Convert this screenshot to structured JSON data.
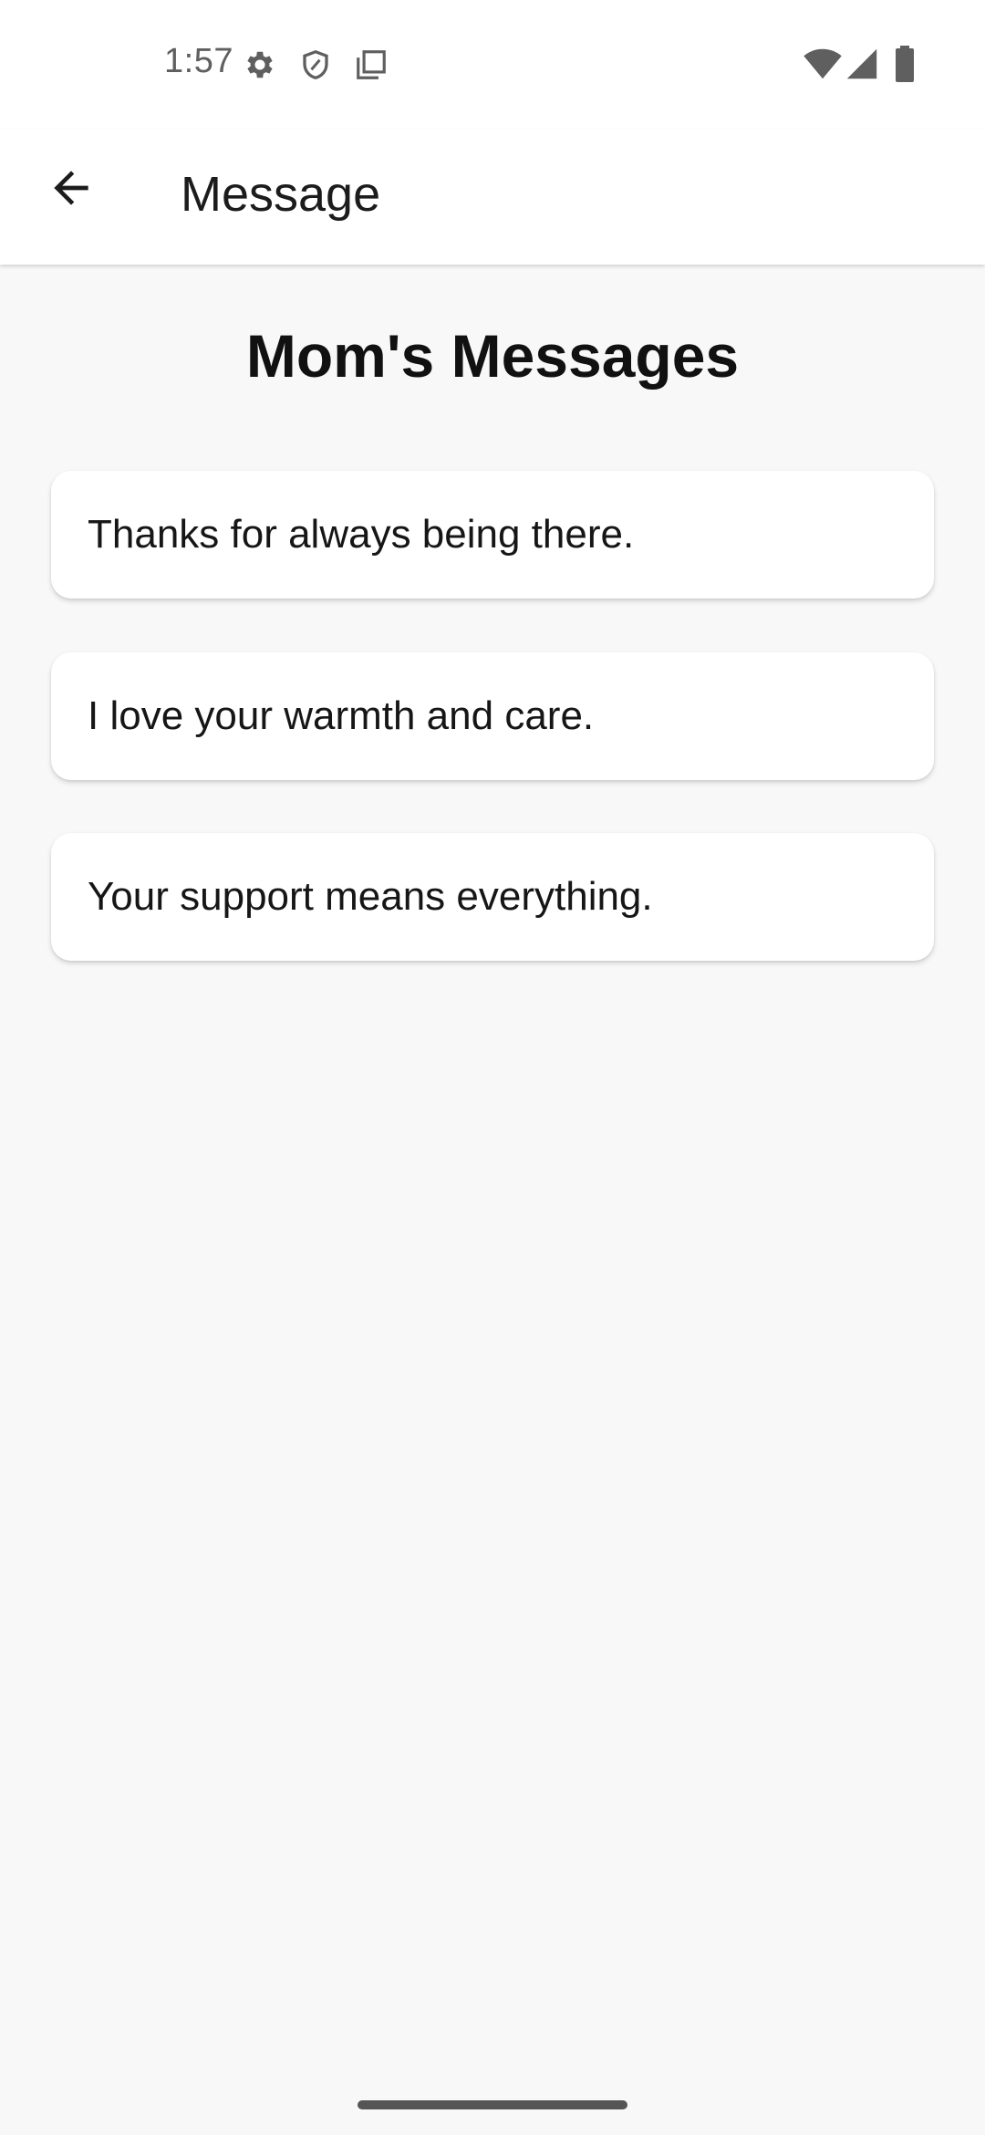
{
  "status_bar": {
    "time": "1:57",
    "icons": [
      "settings-icon",
      "shield-icon",
      "copy-icon",
      "wifi-icon",
      "signal-icon",
      "battery-icon"
    ]
  },
  "app_bar": {
    "back_icon": "arrow-back-icon",
    "title": "Message"
  },
  "main": {
    "heading": "Mom's Messages",
    "messages": [
      "Thanks for always being there.",
      "I love your warmth and care.",
      "Your support means everything."
    ]
  },
  "colors": {
    "background": "#f8f8f8",
    "surface": "#ffffff",
    "text": "#1c1c1c",
    "status_text": "#5f5f5f"
  }
}
